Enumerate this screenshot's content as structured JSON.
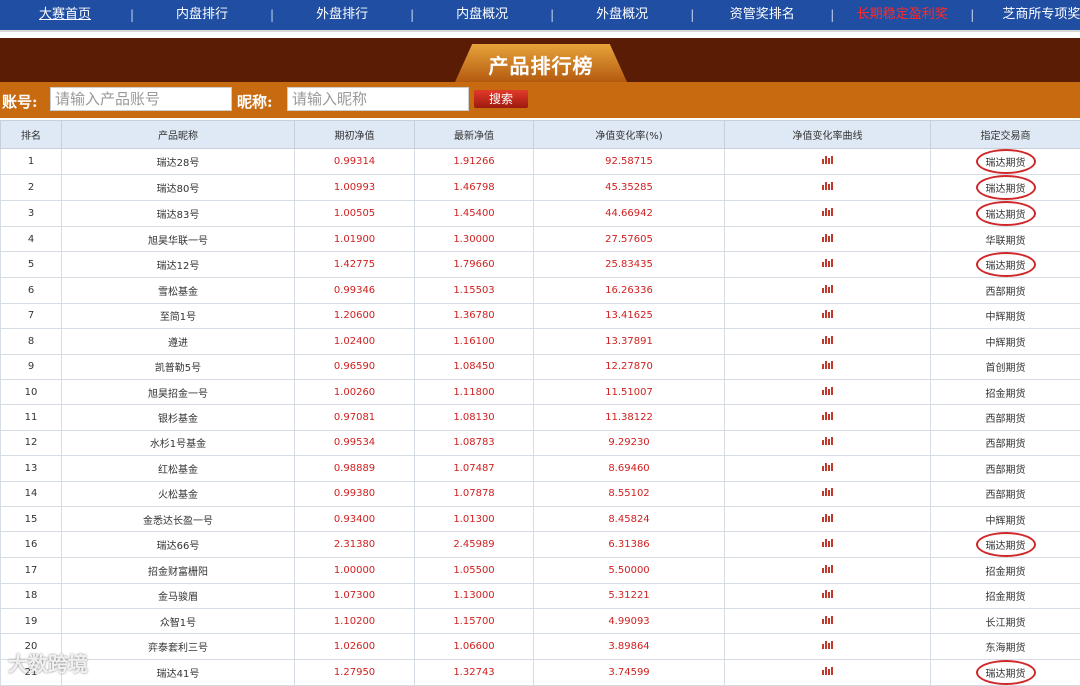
{
  "nav": {
    "items": [
      {
        "label": "大赛首页",
        "style": "underline"
      },
      {
        "label": "内盘排行",
        "style": ""
      },
      {
        "label": "外盘排行",
        "style": ""
      },
      {
        "label": "内盘概况",
        "style": ""
      },
      {
        "label": "外盘概况",
        "style": ""
      },
      {
        "label": "资管奖排名",
        "style": ""
      },
      {
        "label": "长期稳定盈利奖",
        "style": "hot"
      },
      {
        "label": "芝商所专项奖",
        "style": ""
      }
    ]
  },
  "banner": {
    "title": "产品排行榜"
  },
  "search": {
    "account_label": "账号:",
    "account_placeholder": "请输入产品账号",
    "nickname_label": "昵称:",
    "nickname_placeholder": "请输入昵称",
    "button": "搜索"
  },
  "table": {
    "headers": [
      "排名",
      "产品昵称",
      "期初净值",
      "最新净值",
      "净值变化率(%)",
      "净值变化率曲线",
      "指定交易商"
    ],
    "rows": [
      {
        "rank": "1",
        "name": "瑞达28号",
        "start": "0.99314",
        "latest": "1.91266",
        "change": "92.58715",
        "broker": "瑞达期货",
        "circled": true
      },
      {
        "rank": "2",
        "name": "瑞达80号",
        "start": "1.00993",
        "latest": "1.46798",
        "change": "45.35285",
        "broker": "瑞达期货",
        "circled": true
      },
      {
        "rank": "3",
        "name": "瑞达83号",
        "start": "1.00505",
        "latest": "1.45400",
        "change": "44.66942",
        "broker": "瑞达期货",
        "circled": true
      },
      {
        "rank": "4",
        "name": "旭昊华联一号",
        "start": "1.01900",
        "latest": "1.30000",
        "change": "27.57605",
        "broker": "华联期货",
        "circled": false
      },
      {
        "rank": "5",
        "name": "瑞达12号",
        "start": "1.42775",
        "latest": "1.79660",
        "change": "25.83435",
        "broker": "瑞达期货",
        "circled": true
      },
      {
        "rank": "6",
        "name": "雪松基金",
        "start": "0.99346",
        "latest": "1.15503",
        "change": "16.26336",
        "broker": "西部期货",
        "circled": false
      },
      {
        "rank": "7",
        "name": "至简1号",
        "start": "1.20600",
        "latest": "1.36780",
        "change": "13.41625",
        "broker": "中辉期货",
        "circled": false
      },
      {
        "rank": "8",
        "name": "遵进",
        "start": "1.02400",
        "latest": "1.16100",
        "change": "13.37891",
        "broker": "中辉期货",
        "circled": false
      },
      {
        "rank": "9",
        "name": "凯普勒5号",
        "start": "0.96590",
        "latest": "1.08450",
        "change": "12.27870",
        "broker": "首创期货",
        "circled": false
      },
      {
        "rank": "10",
        "name": "旭昊招金一号",
        "start": "1.00260",
        "latest": "1.11800",
        "change": "11.51007",
        "broker": "招金期货",
        "circled": false
      },
      {
        "rank": "11",
        "name": "银杉基金",
        "start": "0.97081",
        "latest": "1.08130",
        "change": "11.38122",
        "broker": "西部期货",
        "circled": false
      },
      {
        "rank": "12",
        "name": "水杉1号基金",
        "start": "0.99534",
        "latest": "1.08783",
        "change": "9.29230",
        "broker": "西部期货",
        "circled": false
      },
      {
        "rank": "13",
        "name": "红松基金",
        "start": "0.98889",
        "latest": "1.07487",
        "change": "8.69460",
        "broker": "西部期货",
        "circled": false
      },
      {
        "rank": "14",
        "name": "火松基金",
        "start": "0.99380",
        "latest": "1.07878",
        "change": "8.55102",
        "broker": "西部期货",
        "circled": false
      },
      {
        "rank": "15",
        "name": "金悉达长盈一号",
        "start": "0.93400",
        "latest": "1.01300",
        "change": "8.45824",
        "broker": "中辉期货",
        "circled": false
      },
      {
        "rank": "16",
        "name": "瑞达66号",
        "start": "2.31380",
        "latest": "2.45989",
        "change": "6.31386",
        "broker": "瑞达期货",
        "circled": true
      },
      {
        "rank": "17",
        "name": "招金财富栅阳",
        "start": "1.00000",
        "latest": "1.05500",
        "change": "5.50000",
        "broker": "招金期货",
        "circled": false
      },
      {
        "rank": "18",
        "name": "金马骏眉",
        "start": "1.07300",
        "latest": "1.13000",
        "change": "5.31221",
        "broker": "招金期货",
        "circled": false
      },
      {
        "rank": "19",
        "name": "众智1号",
        "start": "1.10200",
        "latest": "1.15700",
        "change": "4.99093",
        "broker": "长江期货",
        "circled": false
      },
      {
        "rank": "20",
        "name": "弈泰套利三号",
        "start": "1.02600",
        "latest": "1.06600",
        "change": "3.89864",
        "broker": "东海期货",
        "circled": false
      },
      {
        "rank": "21",
        "name": "瑞达41号",
        "start": "1.27950",
        "latest": "1.32743",
        "change": "3.74599",
        "broker": "瑞达期货",
        "circled": true
      }
    ]
  },
  "watermark": "大数跨境"
}
